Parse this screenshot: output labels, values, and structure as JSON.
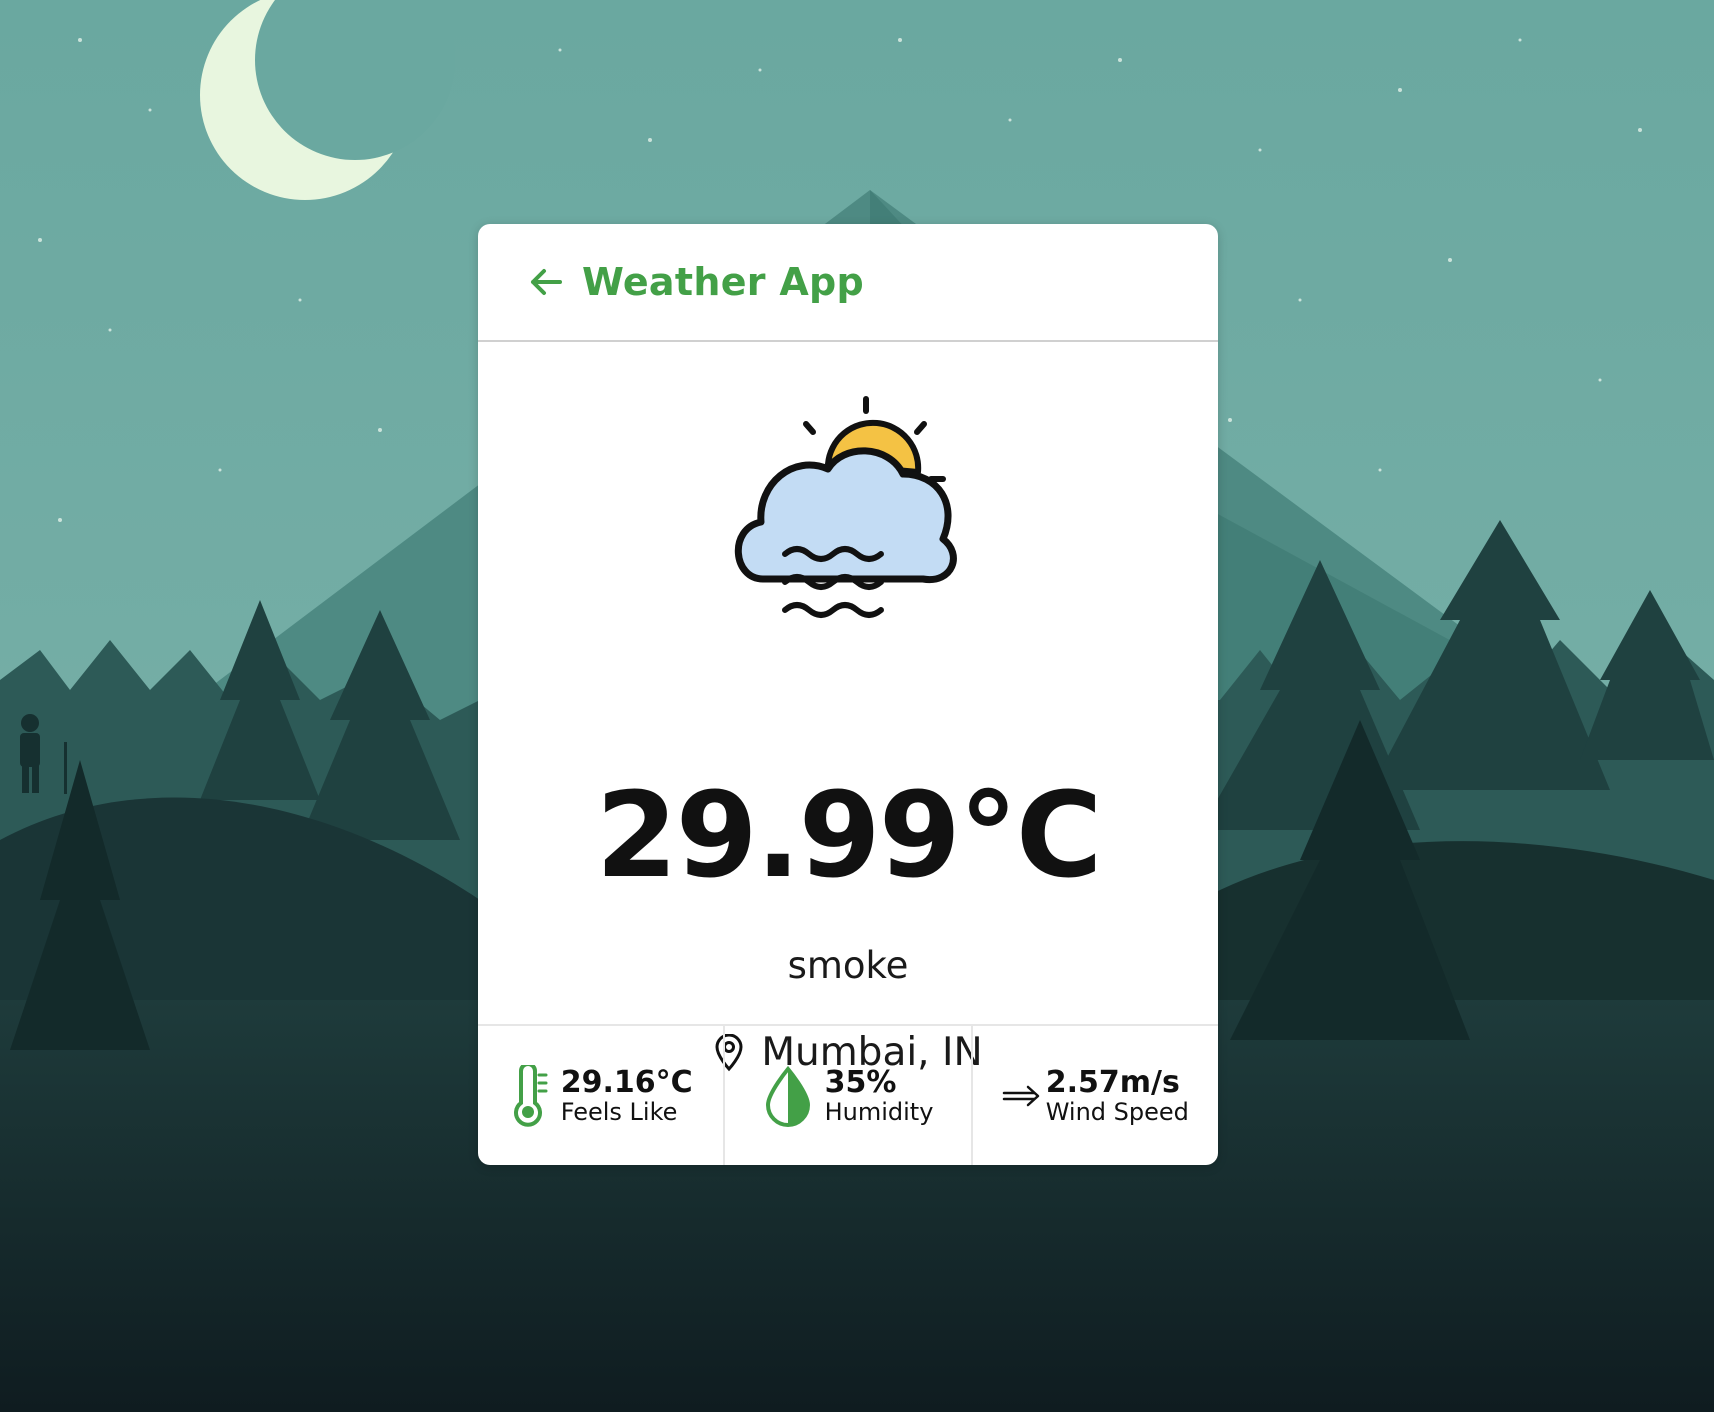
{
  "app": {
    "title": "Weather App",
    "accent_color": "#43a047"
  },
  "weather": {
    "icon": "cloud-sun-fog-icon",
    "temperature": "29.99°C",
    "description": "smoke",
    "location": "Mumbai, IN"
  },
  "details": [
    {
      "icon": "thermometer-icon",
      "value": "29.16°C",
      "label": "Feels Like"
    },
    {
      "icon": "droplet-icon",
      "value": "35%",
      "label": "Humidity"
    },
    {
      "icon": "wind-arrow-icon",
      "value": "2.57m/s",
      "label": "Wind Speed"
    }
  ]
}
